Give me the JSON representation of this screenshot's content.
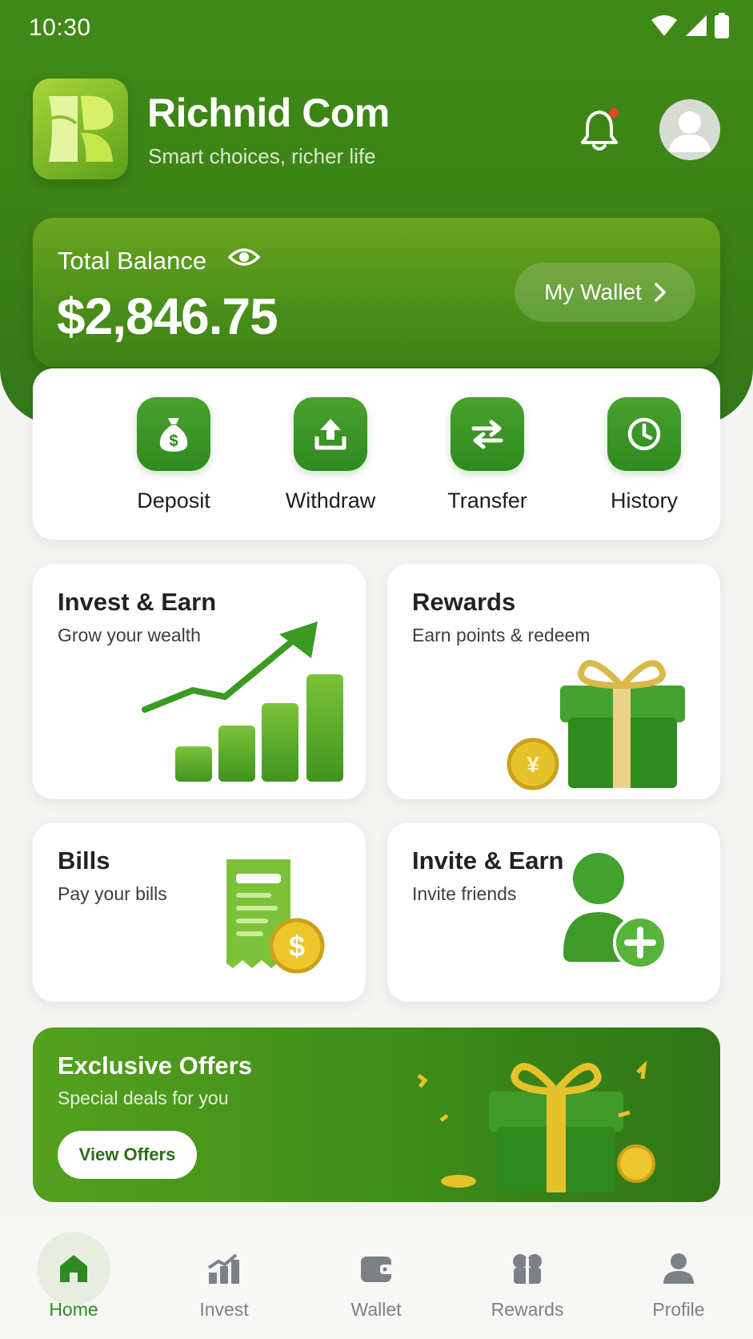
{
  "status_bar": {
    "time": "10:30"
  },
  "header": {
    "app_name": "Richnid Com",
    "tagline": "Smart choices, richer life"
  },
  "balance": {
    "label": "Total Balance",
    "amount": "$2,846.75",
    "wallet_button": "My Wallet"
  },
  "quick_actions": [
    {
      "label": "Deposit",
      "icon": "money-bag-icon"
    },
    {
      "label": "Withdraw",
      "icon": "upload-icon"
    },
    {
      "label": "Transfer",
      "icon": "transfer-arrows-icon"
    },
    {
      "label": "History",
      "icon": "clock-icon"
    }
  ],
  "tiles": {
    "invest": {
      "title": "Invest & Earn",
      "subtitle": "Grow your wealth"
    },
    "rewards": {
      "title": "Rewards",
      "subtitle": "Earn points & redeem"
    },
    "bills": {
      "title": "Bills",
      "subtitle": "Pay your bills"
    },
    "invite": {
      "title": "Invite & Earn",
      "subtitle": "Invite friends"
    }
  },
  "offers": {
    "title": "Exclusive Offers",
    "subtitle": "Special deals for you",
    "button": "View Offers"
  },
  "bottom_nav": [
    {
      "label": "Home",
      "icon": "home-icon",
      "active": true
    },
    {
      "label": "Invest",
      "icon": "chart-icon",
      "active": false
    },
    {
      "label": "Wallet",
      "icon": "wallet-icon",
      "active": false
    },
    {
      "label": "Rewards",
      "icon": "gift-icon",
      "active": false
    },
    {
      "label": "Profile",
      "icon": "person-icon",
      "active": false
    }
  ],
  "colors": {
    "brand_green": "#3f8a17",
    "action_green": "#2f8a20",
    "nav_inactive": "#7b8187"
  }
}
